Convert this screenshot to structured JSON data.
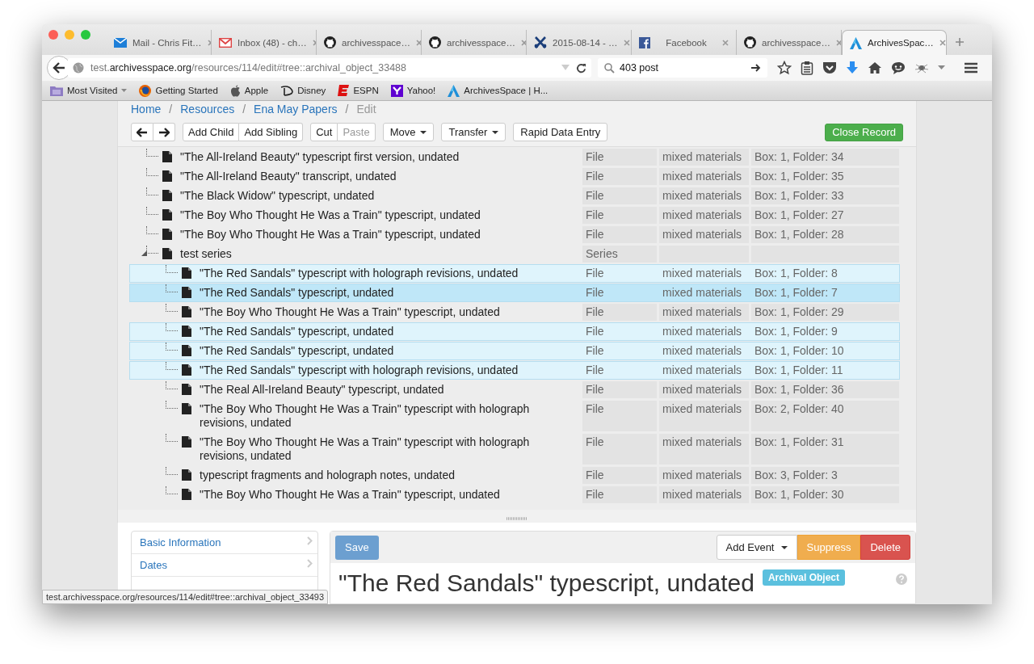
{
  "browser": {
    "tabs": [
      {
        "title": "Mail - Chris Fit…",
        "selected": false
      },
      {
        "title": "Inbox (48) - ch…",
        "selected": false
      },
      {
        "title": "archivesspace…",
        "selected": false
      },
      {
        "title": "archivesspace…",
        "selected": false
      },
      {
        "title": "2015-08-14 - …",
        "selected": false
      },
      {
        "title": "Facebook",
        "selected": false
      },
      {
        "title": "archivesspace…",
        "selected": false
      },
      {
        "title": "ArchivesSpac…",
        "selected": true
      }
    ],
    "url": {
      "scheme": "test.",
      "domain": "archivesspace.org",
      "path": "/resources/114/edit#tree::archival_object_33488"
    },
    "search": {
      "value": "403 post"
    },
    "bookmarks": [
      {
        "label": "Most Visited",
        "folder": true
      },
      {
        "label": "Getting Started",
        "folder": false
      },
      {
        "label": "Apple",
        "folder": false
      },
      {
        "label": "Disney",
        "folder": false
      },
      {
        "label": "ESPN",
        "folder": false
      },
      {
        "label": "Yahoo!",
        "folder": false
      },
      {
        "label": "ArchivesSpace | H...",
        "folder": false
      }
    ],
    "status_url": "test.archivesspace.org/resources/114/edit#tree::archival_object_33493"
  },
  "breadcrumb": [
    {
      "label": "Home",
      "link": true
    },
    {
      "separator": "/",
      "label": "Resources",
      "link": true
    },
    {
      "separator": "/",
      "label": "Ena May Papers",
      "link": true
    },
    {
      "separator": "/",
      "label": "Edit",
      "link": false
    }
  ],
  "toolbar": {
    "groups": [
      [
        {
          "label": "Add Child",
          "disabled": false
        },
        {
          "label": "Add Sibling",
          "disabled": false
        }
      ],
      [
        {
          "label": "Cut",
          "disabled": false
        },
        {
          "label": "Paste",
          "disabled": true
        }
      ],
      [
        {
          "label": "Move",
          "caret": true,
          "disabled": false
        }
      ],
      [
        {
          "label": "Transfer",
          "caret": true,
          "disabled": false
        }
      ],
      [
        {
          "label": "Rapid Data Entry",
          "disabled": false
        }
      ]
    ],
    "close": "Close Record"
  },
  "tree": {
    "rows": [
      {
        "title": "\"The All-Ireland Beauty\" typescript first version, undated",
        "type": "File",
        "extent": "mixed materials",
        "container": "Box: 1, Folder: 34",
        "selected": false,
        "current": false
      },
      {
        "title": "\"The All-Ireland Beauty\" transcript, undated",
        "type": "File",
        "extent": "mixed materials",
        "container": "Box: 1, Folder: 35",
        "selected": false,
        "current": false
      },
      {
        "title": "\"The Black Widow\" typescript, undated",
        "type": "File",
        "extent": "mixed materials",
        "container": "Box: 1, Folder: 33",
        "selected": false,
        "current": false
      },
      {
        "title": "\"The Boy Who Thought He Was a Train\" typescript, undated",
        "type": "File",
        "extent": "mixed materials",
        "container": "Box: 1, Folder: 27",
        "selected": false,
        "current": false
      },
      {
        "title": "\"The Boy Who Thought He Was a Train\" typescript, undated",
        "type": "File",
        "extent": "mixed materials",
        "container": "Box: 1, Folder: 28",
        "selected": false,
        "current": false
      },
      {
        "title": "test series",
        "type": "Series",
        "selected": false,
        "current": false,
        "expanded": true,
        "children": [
          {
            "title": "\"The Red Sandals\" typescript with holograph revisions, undated",
            "type": "File",
            "extent": "mixed materials",
            "container": "Box: 1, Folder: 8",
            "selected": true,
            "current": false
          },
          {
            "title": "\"The Red Sandals\" typescript, undated",
            "type": "File",
            "extent": "mixed materials",
            "container": "Box: 1, Folder: 7",
            "selected": true,
            "current": true
          },
          {
            "title": "\"The Boy Who Thought He Was a Train\" typescript, undated",
            "type": "File",
            "extent": "mixed materials",
            "container": "Box: 1, Folder: 29",
            "selected": false,
            "current": false
          },
          {
            "title": "\"The Red Sandals\" typescript, undated",
            "type": "File",
            "extent": "mixed materials",
            "container": "Box: 1, Folder: 9",
            "selected": true,
            "current": false
          },
          {
            "title": "\"The Red Sandals\" typescript, undated",
            "type": "File",
            "extent": "mixed materials",
            "container": "Box: 1, Folder: 10",
            "selected": true,
            "current": false
          },
          {
            "title": "\"The Red Sandals\" typescript with holograph revisions, undated",
            "type": "File",
            "extent": "mixed materials",
            "container": "Box: 1, Folder: 11",
            "selected": true,
            "current": false
          },
          {
            "title": "\"The Real All-Ireland Beauty\" typescript, undated",
            "type": "File",
            "extent": "mixed materials",
            "container": "Box: 1, Folder: 36",
            "selected": false,
            "current": false
          },
          {
            "title": "\"The Boy Who Thought He Was a Train\" typescript with holograph revisions, undated",
            "type": "File",
            "extent": "mixed materials",
            "container": "Box: 2, Folder: 40",
            "selected": false,
            "current": false
          },
          {
            "title": "\"The Boy Who Thought He Was a Train\" typescript with holograph revisions, undated",
            "type": "File",
            "extent": "mixed materials",
            "container": "Box: 1, Folder: 31",
            "selected": false,
            "current": false
          },
          {
            "title": "typescript fragments and holograph notes, undated",
            "type": "File",
            "extent": "mixed materials",
            "container": "Box: 3, Folder: 3",
            "selected": false,
            "current": false
          },
          {
            "title": "\"The Boy Who Thought He Was a Train\" typescript, undated",
            "type": "File",
            "extent": "mixed materials",
            "container": "Box: 1, Folder: 30",
            "selected": false,
            "current": false
          }
        ]
      }
    ]
  },
  "sidebar": {
    "items": [
      "Basic Information",
      "Dates"
    ]
  },
  "form": {
    "save": "Save",
    "actions": [
      {
        "label": "Add Event",
        "kind": "dropdown"
      },
      {
        "label": "Suppress",
        "kind": "warning"
      },
      {
        "label": "Delete",
        "kind": "danger"
      }
    ],
    "title": "\"The Red Sandals\" typescript, undated",
    "badge": "Archival Object"
  }
}
